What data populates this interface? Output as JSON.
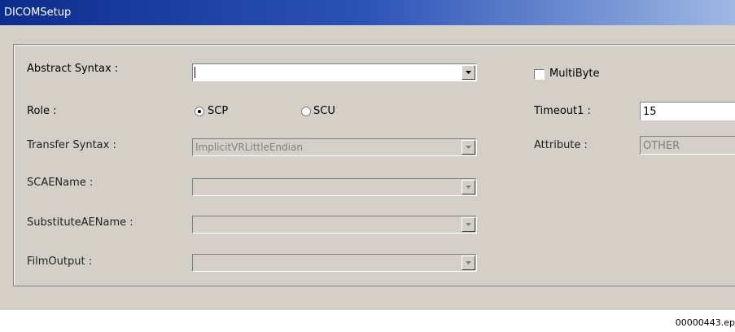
{
  "window": {
    "title": "DICOMSetup"
  },
  "form": {
    "abstract_syntax": {
      "label": "Abstract Syntax :",
      "value": ""
    },
    "role": {
      "label": "Role :",
      "options": [
        "SCP",
        "SCU"
      ],
      "selected": "SCP"
    },
    "transfer_syntax": {
      "label": "Transfer Syntax :",
      "value": "ImplicitVRLittleEndian"
    },
    "scaename": {
      "label": "SCAEName :",
      "value": ""
    },
    "substitute_aename": {
      "label": "SubstituteAEName :",
      "value": ""
    },
    "film_output": {
      "label": "FilmOutput :",
      "value": ""
    },
    "multibyte": {
      "label": "MultiByte",
      "checked": false
    },
    "timeout1": {
      "label": "Timeout1 :",
      "value": "15"
    },
    "attribute": {
      "label": "Attribute :",
      "value": "OTHER"
    }
  },
  "footer": {
    "caption": "00000443.ep"
  }
}
